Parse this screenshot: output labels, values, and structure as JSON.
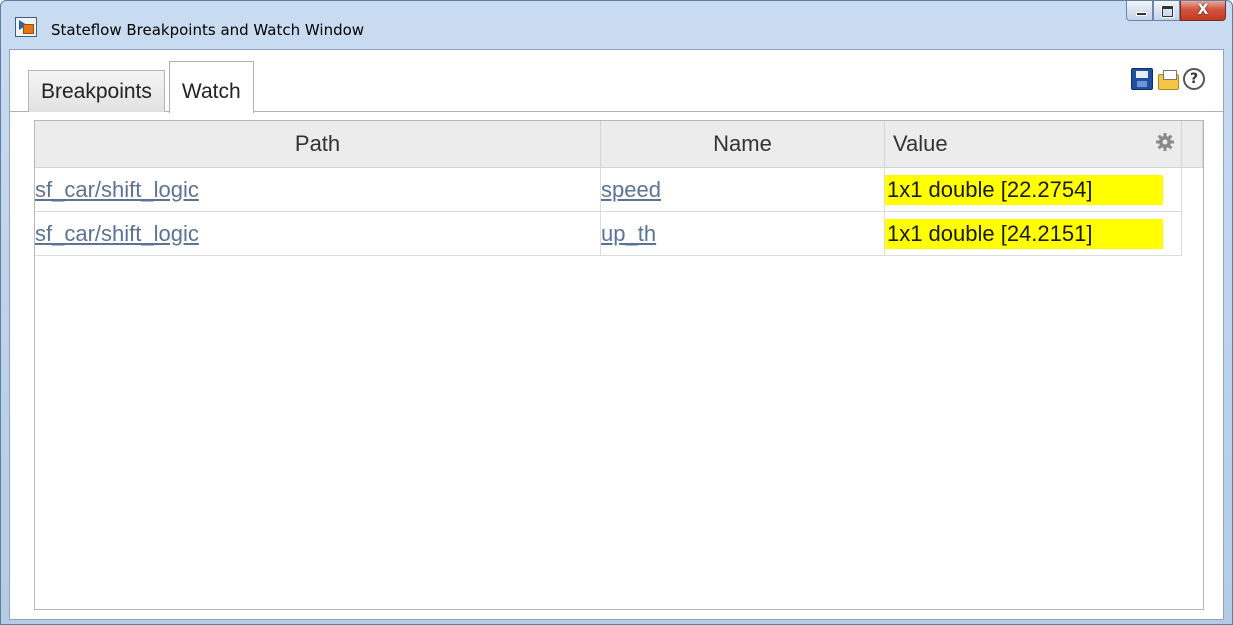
{
  "window": {
    "title": "Stateflow Breakpoints and Watch Window",
    "controls": {
      "close_label": "X"
    }
  },
  "tabs": [
    {
      "label": "Breakpoints",
      "active": false
    },
    {
      "label": "Watch",
      "active": true
    }
  ],
  "toolbar": {
    "icons": [
      "save-icon",
      "open-folder-icon",
      "help-icon"
    ],
    "help_glyph": "?"
  },
  "watch_table": {
    "columns": {
      "path": "Path",
      "name": "Name",
      "value": "Value"
    },
    "rows": [
      {
        "path": "sf_car/shift_logic",
        "name": "speed",
        "value": "1x1 double [22.2754]"
      },
      {
        "path": "sf_car/shift_logic",
        "name": "up_th",
        "value": "1x1 double [24.2151]"
      }
    ]
  },
  "colors": {
    "value_highlight": "#ffff00",
    "link": "#5b7394",
    "title_bar": "#c9dcf1"
  }
}
